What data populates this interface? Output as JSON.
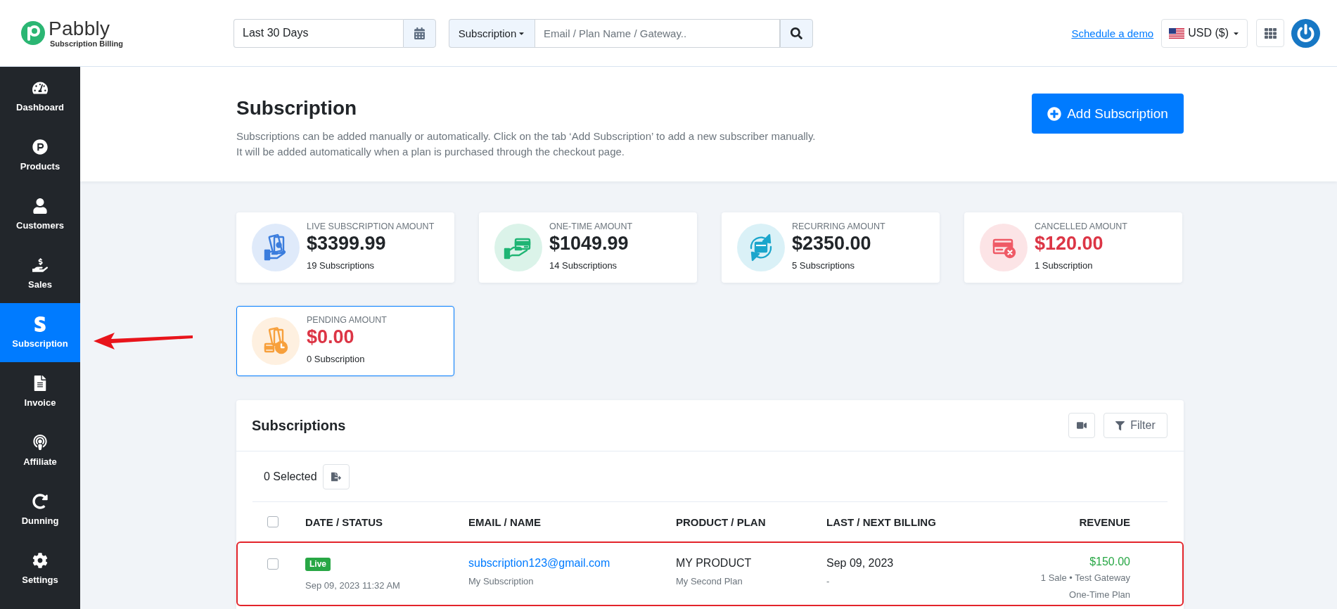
{
  "brand": {
    "name": "Pabbly",
    "tagline": "Subscription Billing"
  },
  "topbar": {
    "date_range": "Last 30 Days",
    "search_scope": "Subscription",
    "search_placeholder": "Email / Plan Name / Gateway..",
    "demo_link": "Schedule a demo",
    "currency": "USD ($)"
  },
  "sidebar": {
    "items": [
      {
        "kind": "dashboard",
        "label": "Dashboard",
        "selected": false
      },
      {
        "kind": "products",
        "label": "Products",
        "selected": false
      },
      {
        "kind": "customers",
        "label": "Customers",
        "selected": false
      },
      {
        "kind": "sales",
        "label": "Sales",
        "selected": false
      },
      {
        "kind": "subscription",
        "label": "Subscription",
        "selected": true
      },
      {
        "kind": "invoice",
        "label": "Invoice",
        "selected": false
      },
      {
        "kind": "affiliate",
        "label": "Affiliate",
        "selected": false
      },
      {
        "kind": "dunning",
        "label": "Dunning",
        "selected": false
      },
      {
        "kind": "settings",
        "label": "Settings",
        "selected": false
      }
    ]
  },
  "page": {
    "title": "Subscription",
    "description": [
      "Subscriptions can be added manually or automatically. Click on the tab ‘Add Subscription’ to add a new subscriber manually.",
      "It will be added automatically when a plan is purchased through the checkout page."
    ],
    "add_button": "Add Subscription"
  },
  "stats": [
    {
      "icon": {
        "kind": "live",
        "color": "#3b7ddd"
      },
      "label": "LIVE SUBSCRIPTION AMOUNT",
      "amount": {
        "text": "$3399.99",
        "color": "#212529"
      },
      "count": "19 Subscriptions",
      "selected": false
    },
    {
      "icon": {
        "kind": "one_time",
        "color": "#1fb574"
      },
      "label": "ONE-TIME AMOUNT",
      "amount": {
        "text": "$1049.99",
        "color": "#212529"
      },
      "count": "14 Subscriptions",
      "selected": false
    },
    {
      "icon": {
        "kind": "recurring",
        "color": "#1ba6cc"
      },
      "label": "RECURRING AMOUNT",
      "amount": {
        "text": "$2350.00",
        "color": "#212529"
      },
      "count": "5 Subscriptions",
      "selected": false
    },
    {
      "icon": {
        "kind": "cancelled",
        "color": "#ef5a66"
      },
      "label": "CANCELLED AMOUNT",
      "amount": {
        "text": "$120.00",
        "color": "#dc3545"
      },
      "count": "1 Subscription",
      "selected": false
    },
    {
      "icon": {
        "kind": "pending",
        "color": "#f7a03c"
      },
      "label": "PENDING AMOUNT",
      "amount": {
        "text": "$0.00",
        "color": "#dc3545"
      },
      "count": "0 Subscription",
      "selected": true
    }
  ],
  "table": {
    "title": "Subscriptions",
    "filter_button": "Filter",
    "selected_count": "0 Selected",
    "select_all_checked": false,
    "columns": [
      "DATE / STATUS",
      "EMAIL / NAME",
      "PRODUCT / PLAN",
      "LAST / NEXT BILLING",
      "REVENUE"
    ],
    "rows": [
      {
        "checked": false,
        "highlighted": true,
        "status": {
          "label": "Live",
          "color": "#28a745"
        },
        "date": "Sep 09, 2023 11:32 AM",
        "email": "subscription123@gmail.com",
        "name": "My Subscription",
        "product": "MY PRODUCT",
        "plan": "My Second Plan",
        "last_billing": "Sep 09, 2023",
        "next_billing": "-",
        "revenue": "$150.00",
        "revenue_detail": "1 Sale • Test Gateway",
        "plan_type": "One-Time Plan"
      }
    ]
  }
}
